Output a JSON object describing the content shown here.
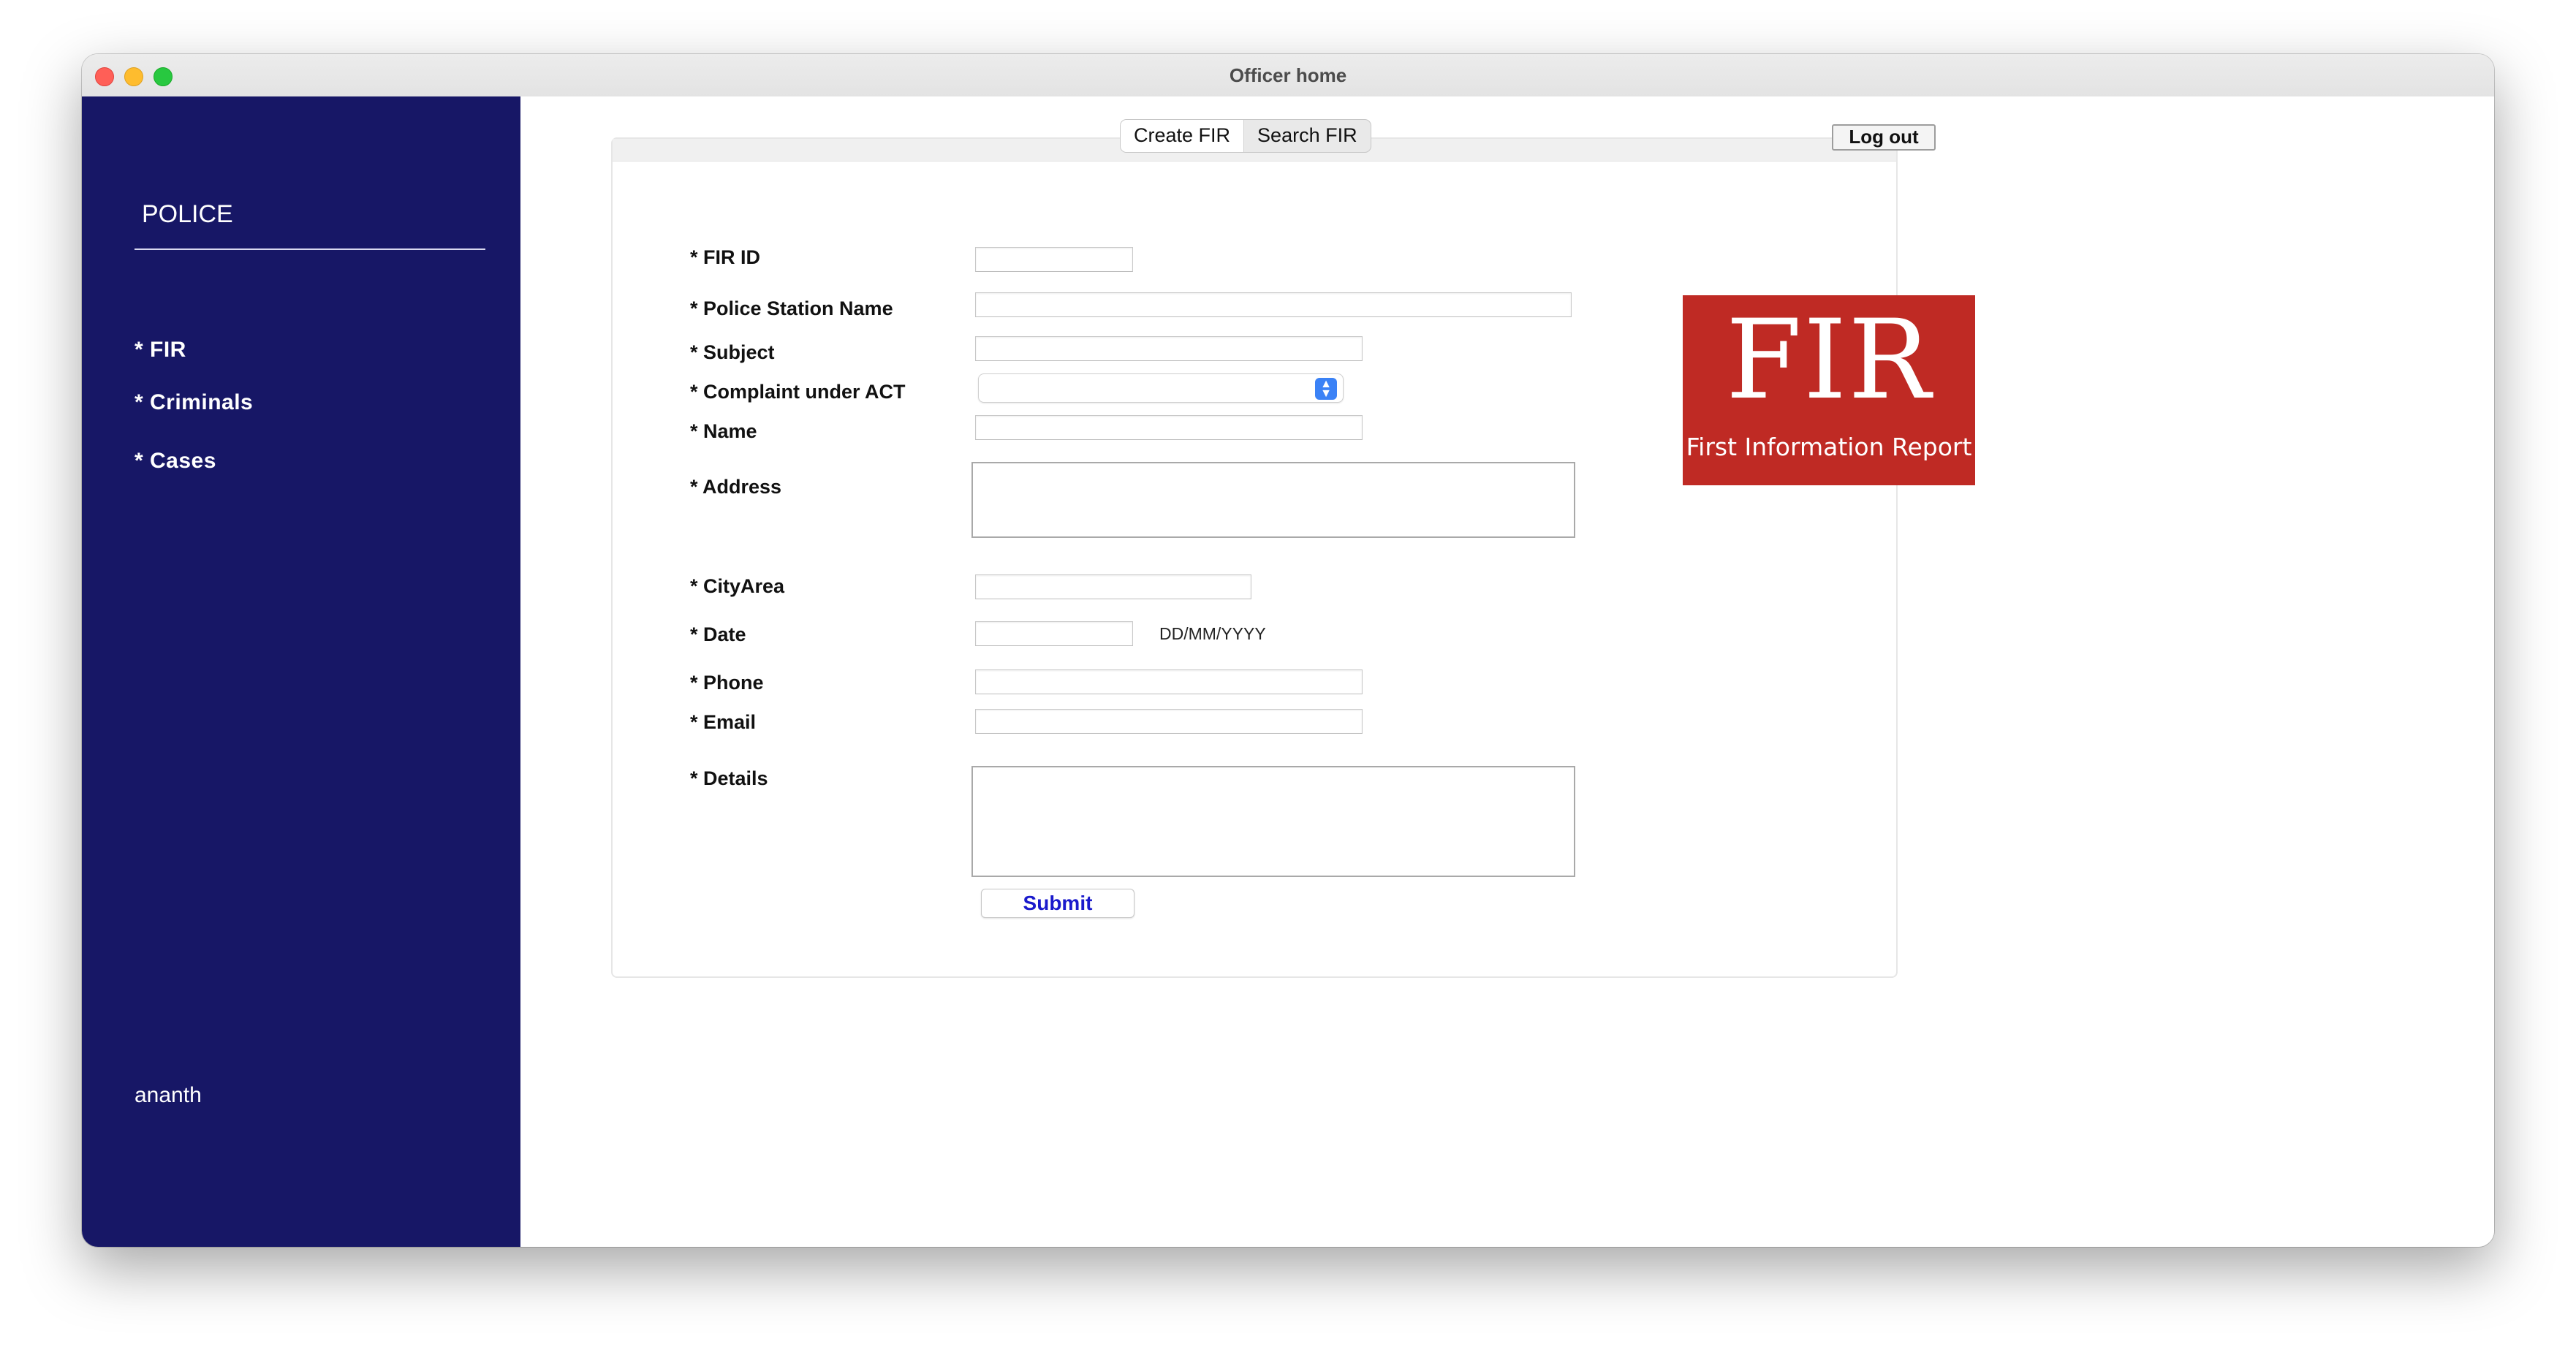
{
  "window": {
    "title": "Officer home"
  },
  "sidebar": {
    "brand": "POLICE",
    "items": [
      {
        "label": "* FIR"
      },
      {
        "label": "* Criminals"
      },
      {
        "label": "* Cases"
      }
    ],
    "user": "ananth"
  },
  "tabs": [
    {
      "label": "Create FIR",
      "active": true
    },
    {
      "label": "Search FIR",
      "active": false
    }
  ],
  "logout_label": "Log out",
  "form": {
    "labels": {
      "fir_id": "* FIR ID",
      "police_station": "* Police Station Name",
      "subject": "* Subject",
      "complaint_act": "* Complaint under ACT",
      "name": "* Name",
      "address": "* Address",
      "city_area": "* CityArea",
      "date": "* Date",
      "phone": "* Phone",
      "email": "* Email",
      "details": "* Details"
    },
    "values": {
      "fir_id": "",
      "police_station": "",
      "subject": "",
      "complaint_act": "",
      "name": "",
      "address": "",
      "city_area": "",
      "date": "",
      "phone": "",
      "email": "",
      "details": ""
    },
    "date_hint": "DD/MM/YYYY",
    "submit_label": "Submit"
  },
  "fir_image": {
    "title": "FIR",
    "subtitle": "First Information Report",
    "background": "#bf2a24"
  },
  "colors": {
    "sidebar_bg": "#171766",
    "submit_text": "#1a1acc",
    "select_arrow": "#3b82f6"
  }
}
